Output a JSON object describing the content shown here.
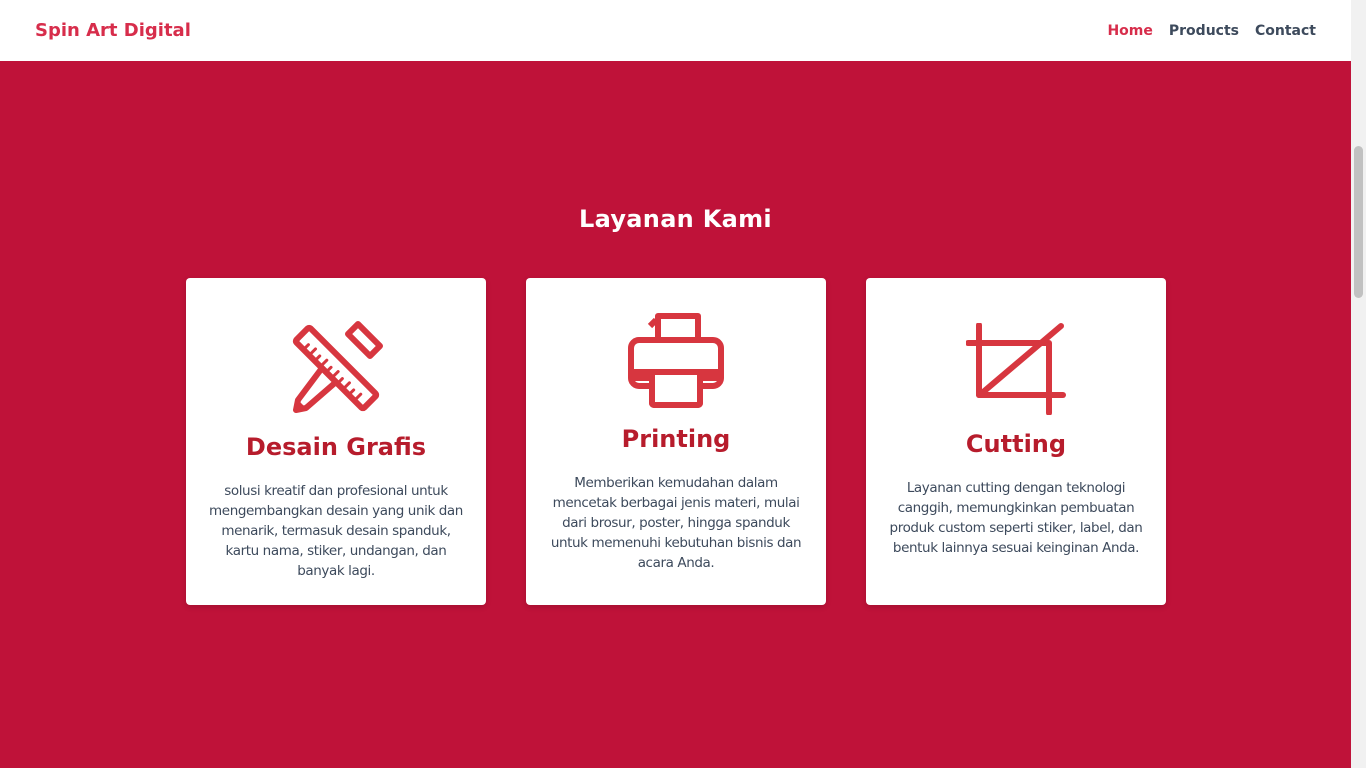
{
  "navbar": {
    "brand": "Spin Art Digital",
    "links": [
      {
        "label": "Home",
        "active": true
      },
      {
        "label": "Products",
        "active": false
      },
      {
        "label": "Contact",
        "active": false
      }
    ]
  },
  "services": {
    "title": "Layanan Kami",
    "cards": [
      {
        "icon": "ruler-pencil-icon",
        "title": "Desain Grafis",
        "description": "solusi kreatif dan profesional untuk mengembangkan desain yang unik dan menarik, termasuk desain spanduk, kartu nama, stiker, undangan, dan banyak lagi."
      },
      {
        "icon": "printer-icon",
        "title": "Printing",
        "description": "Memberikan kemudahan dalam mencetak berbagai jenis materi, mulai dari brosur, poster, hingga spanduk untuk memenuhi kebutuhan bisnis dan acara Anda."
      },
      {
        "icon": "crop-icon",
        "title": "Cutting",
        "description": "Layanan cutting dengan teknologi canggih, memungkinkan pembuatan produk custom seperti stiker, label, dan bentuk lainnya sesuai keinginan Anda."
      }
    ]
  },
  "colors": {
    "brand": "#d72d4b",
    "section_bg": "#bf1239",
    "card_title": "#b71c2c",
    "icon": "#d7363f"
  }
}
